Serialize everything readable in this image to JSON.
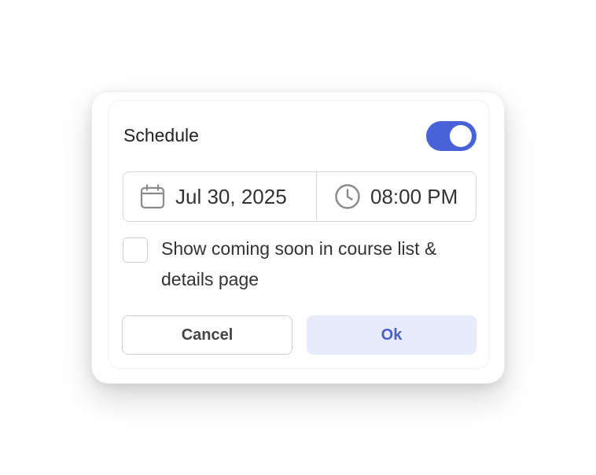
{
  "schedule": {
    "title": "Schedule",
    "enabled": true
  },
  "datetime": {
    "date": "Jul 30, 2025",
    "time": "08:00 PM",
    "date_icon": "calendar-icon",
    "time_icon": "clock-icon"
  },
  "coming_soon": {
    "checked": false,
    "label": "Show coming soon in course list & details page"
  },
  "actions": {
    "cancel_label": "Cancel",
    "ok_label": "Ok"
  },
  "colors": {
    "accent": "#4a62d8",
    "ok_background": "#e8ecfa",
    "ok_text": "#4a5fc9"
  }
}
